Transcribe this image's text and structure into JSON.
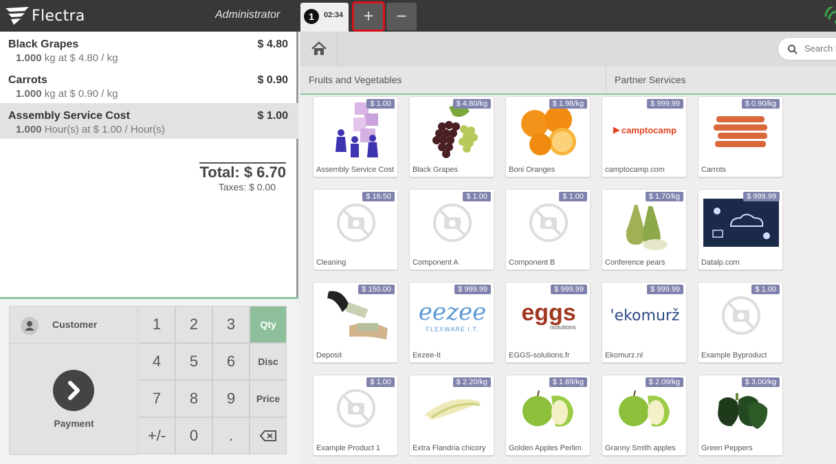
{
  "topbar": {
    "brand": "Flectra",
    "user": "Administrator",
    "order_number": "1",
    "order_time": "02:34",
    "add_label": "+",
    "remove_label": "−"
  },
  "order": {
    "lines": [
      {
        "name": "Black Grapes",
        "price": "$ 4.80",
        "qty": "1.000",
        "detail": "kg at $ 4.80 / kg"
      },
      {
        "name": "Carrots",
        "price": "$ 0.90",
        "qty": "1.000",
        "detail": "kg at $ 0.90 / kg"
      },
      {
        "name": "Assembly Service Cost",
        "price": "$ 1.00",
        "qty": "1.000",
        "detail": "Hour(s) at $ 1.00 / Hour(s)"
      }
    ],
    "total": "Total: $ 6.70",
    "taxes": "Taxes: $ 0.00"
  },
  "actionpad": {
    "customer": "Customer",
    "payment": "Payment"
  },
  "numpad": {
    "k1": "1",
    "k2": "2",
    "k3": "3",
    "k4": "4",
    "k5": "5",
    "k6": "6",
    "k7": "7",
    "k8": "8",
    "k9": "9",
    "sign": "+/-",
    "k0": "0",
    "dot": ".",
    "qty": "Qty",
    "disc": "Disc",
    "price": "Price"
  },
  "search": {
    "label": "Search P"
  },
  "categories": [
    "Fruits and Vegetables",
    "Partner Services"
  ],
  "products": [
    {
      "name": "Assembly Service Cost",
      "price": "$ 1.00",
      "icon": "puzzle-people"
    },
    {
      "name": "Black Grapes",
      "price": "$ 4.80/kg",
      "icon": "grapes"
    },
    {
      "name": "Boni Oranges",
      "price": "$ 1.98/kg",
      "icon": "oranges"
    },
    {
      "name": "camptocamp.com",
      "price": "$ 999.99",
      "icon": "logo",
      "logo_text": "camptocamp"
    },
    {
      "name": "Carrots",
      "price": "$ 0.90/kg",
      "icon": "carrots"
    },
    {
      "name": "Cleaning",
      "price": "$ 16.50",
      "icon": "no-image"
    },
    {
      "name": "Component A",
      "price": "$ 1.00",
      "icon": "no-image"
    },
    {
      "name": "Component B",
      "price": "$ 1.00",
      "icon": "no-image"
    },
    {
      "name": "Conference pears",
      "price": "$ 1.70/kg",
      "icon": "pears"
    },
    {
      "name": "Datalp.com",
      "price": "$ 999.99",
      "icon": "cloud"
    },
    {
      "name": "Deposit",
      "price": "$ 150.00",
      "icon": "money"
    },
    {
      "name": "Eezee-It",
      "price": "$ 999.99",
      "icon": "eezee",
      "logo_text": "eezee",
      "logo_sub": "FLEXWARE I.T."
    },
    {
      "name": "EGGS-solutions.fr",
      "price": "$ 999.99",
      "icon": "eggs",
      "logo_text": "eggs",
      "logo_sub": "/solutions"
    },
    {
      "name": "Ekomurz.nl",
      "price": "$ 999.99",
      "icon": "ekomurz",
      "logo_text": "'ekomurž"
    },
    {
      "name": "Example Byproduct",
      "price": "$ 1.00",
      "icon": "no-image"
    },
    {
      "name": "Example Product 1",
      "price": "$ 1.00",
      "icon": "no-image"
    },
    {
      "name": "Extra Flandria chicory",
      "price": "$ 2.20/kg",
      "icon": "chicory"
    },
    {
      "name": "Golden Apples Perlim",
      "price": "$ 1.69/kg",
      "icon": "green-apples"
    },
    {
      "name": "Granny Smith apples",
      "price": "$ 2.09/kg",
      "icon": "green-apples"
    },
    {
      "name": "Green Peppers",
      "price": "$ 3.00/kg",
      "icon": "peppers"
    }
  ]
}
